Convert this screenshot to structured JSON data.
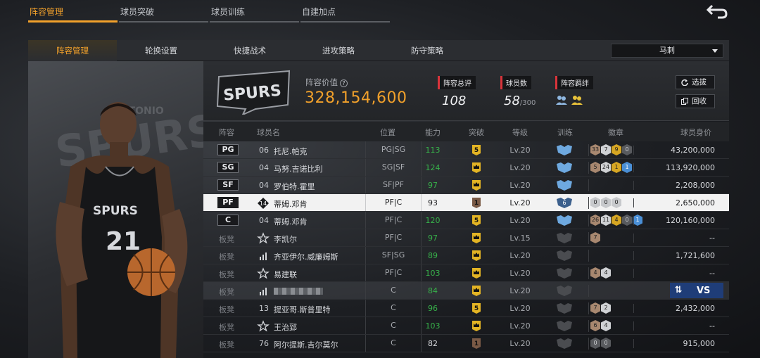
{
  "top_tabs": [
    "阵容管理",
    "球员突破",
    "球员训练",
    "自建加点"
  ],
  "sub_tabs": [
    "阵容管理",
    "轮换设置",
    "快捷战术",
    "进攻策略",
    "防守策略"
  ],
  "team_select": {
    "value": "马刺"
  },
  "summary": {
    "value_label": "阵容价值",
    "value": "328,154,600",
    "rating_label": "阵容总评",
    "rating": "108",
    "players_label": "球员数",
    "players": "58",
    "players_max": "/300",
    "bond_label": "阵容羁绊",
    "btn_select": "选拔",
    "btn_recall": "回收"
  },
  "columns": [
    "阵容",
    "球员名",
    "位置",
    "能力",
    "突破",
    "等级",
    "训练",
    "徽章",
    "球员身价"
  ],
  "rows": [
    {
      "lineup": "PG",
      "starter": true,
      "jersey": "06",
      "name": "托尼.帕克",
      "pos": "PG|SG",
      "ability": "113",
      "bt": "5",
      "bt_style": "gold",
      "level": "Lv.20",
      "train": "blue",
      "badges": [
        [
          "33",
          "bronze"
        ],
        [
          "7",
          "silver"
        ],
        [
          "9",
          "gold"
        ],
        [
          "0",
          "dark"
        ]
      ],
      "salary": "43,200,000"
    },
    {
      "lineup": "SG",
      "starter": true,
      "jersey": "04",
      "name": "马努.吉诺比利",
      "pos": "SG|SF",
      "ability": "124",
      "bt": "",
      "bt_style": "crown",
      "level": "Lv.20",
      "train": "blue",
      "badges": [
        [
          "5",
          "bronze"
        ],
        [
          "24",
          "silver"
        ],
        [
          "1",
          "gold"
        ],
        [
          "1",
          "blue"
        ]
      ],
      "salary": "113,920,000"
    },
    {
      "lineup": "SF",
      "starter": true,
      "jersey": "04",
      "name": "罗伯特.霍里",
      "pos": "SF|PF",
      "ability": "97",
      "bt": "",
      "bt_style": "crown",
      "level": "Lv.20",
      "train": "blue",
      "badges": [],
      "salary": "2,208,000"
    },
    {
      "lineup": "PF",
      "starter": true,
      "selected": true,
      "jersey": "14",
      "jersey_icon": true,
      "name": "蒂姆.邓肯",
      "pos": "PF|C",
      "ability": "93",
      "bt": "1",
      "bt_style": "brown",
      "level": "Lv.20",
      "train": "dark6",
      "badges": [
        [
          "0",
          "grey"
        ],
        [
          "0",
          "grey"
        ],
        [
          "0",
          "grey"
        ]
      ],
      "salary": "2,650,000"
    },
    {
      "lineup": "C",
      "starter": true,
      "jersey": "04",
      "name": "蒂姆.邓肯",
      "pos": "PF|C",
      "ability": "120",
      "bt": "5",
      "bt_style": "gold",
      "level": "Lv.20",
      "train": "blue",
      "badges": [
        [
          "26",
          "bronze"
        ],
        [
          "11",
          "silver"
        ],
        [
          "4",
          "gold"
        ],
        [
          "0",
          "dark"
        ],
        [
          "1",
          "blue"
        ]
      ],
      "salary": "120,160,000"
    },
    {
      "lineup": "板凳",
      "starter": false,
      "jersey": "",
      "jersey_icon_type": "star",
      "name": "李凯尔",
      "pos": "PF|C",
      "ability": "97",
      "bt": "",
      "bt_style": "crown",
      "level": "Lv.15",
      "train": "grey",
      "badges": [
        [
          "7",
          "bronze"
        ]
      ],
      "salary": "--"
    },
    {
      "lineup": "板凳",
      "starter": false,
      "jersey": "",
      "jersey_icon_type": "bars",
      "name": "齐亚伊尔.威廉姆斯",
      "pos": "SF|SG",
      "ability": "89",
      "bt": "",
      "bt_style": "crown",
      "level": "Lv.20",
      "train": "grey",
      "badges": [],
      "salary": "1,721,600"
    },
    {
      "lineup": "板凳",
      "starter": false,
      "jersey": "",
      "jersey_icon_type": "star",
      "name": "易建联",
      "pos": "PF|C",
      "ability": "103",
      "bt": "",
      "bt_style": "crown",
      "level": "Lv.20",
      "train": "grey",
      "badges": [
        [
          "4",
          "bronze"
        ],
        [
          "4",
          "silver"
        ]
      ],
      "salary": "--"
    },
    {
      "lineup": "板凳",
      "starter": false,
      "dim": true,
      "jersey": "",
      "jersey_icon_type": "bars",
      "name": "",
      "pos": "C",
      "ability": "84",
      "bt": "",
      "bt_style": "crown",
      "level": "Lv.20",
      "train": "grey",
      "badges": [],
      "salary": "",
      "vs": "VS"
    },
    {
      "lineup": "板凳",
      "starter": false,
      "jersey": "13",
      "name": "提亚哥.斯普里特",
      "pos": "C",
      "ability": "96",
      "bt": "5",
      "bt_style": "gold",
      "level": "Lv.20",
      "train": "grey",
      "badges": [
        [
          "7",
          "bronze"
        ],
        [
          "2",
          "silver"
        ]
      ],
      "salary": "2,432,000"
    },
    {
      "lineup": "板凳",
      "starter": false,
      "jersey": "",
      "jersey_icon_type": "star",
      "name": "王治郅",
      "pos": "C",
      "ability": "103",
      "bt": "",
      "bt_style": "crown",
      "level": "Lv.20",
      "train": "grey",
      "badges": [
        [
          "6",
          "bronze"
        ],
        [
          "4",
          "silver"
        ]
      ],
      "salary": "--"
    },
    {
      "lineup": "板凳",
      "starter": false,
      "jersey": "76",
      "name": "阿尔提斯.吉尔莫尔",
      "pos": "C",
      "ability": "82",
      "bt": "1",
      "bt_style": "brown",
      "level": "Lv.20",
      "train": "grey",
      "badges": [
        [
          "0",
          "dark"
        ],
        [
          "0",
          "dark"
        ]
      ],
      "salary": "915,000"
    }
  ],
  "player_card": {
    "jersey_number": "21",
    "team_text": "SPURS"
  },
  "logo_text": {
    "top": "ANTONIO",
    "main": "SPURS"
  },
  "colors": {
    "accent": "#f2a12b",
    "ability_green": "#37b24a",
    "vs_blue": "#1f3d78",
    "tag_red": "#d9343b"
  }
}
